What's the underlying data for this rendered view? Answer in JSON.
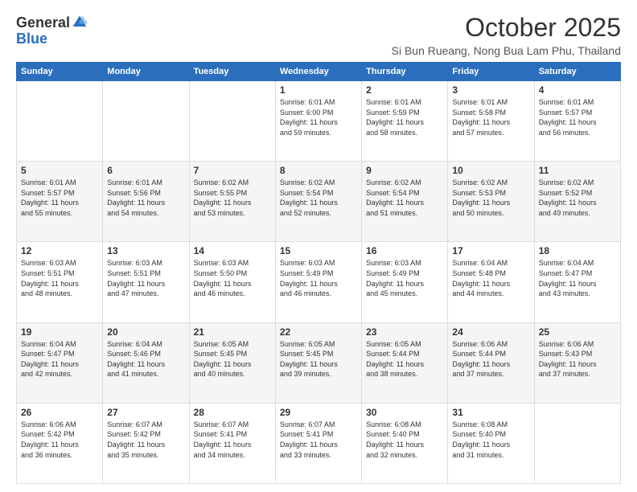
{
  "header": {
    "logo_general": "General",
    "logo_blue": "Blue",
    "month_title": "October 2025",
    "location": "Si Bun Rueang, Nong Bua Lam Phu, Thailand"
  },
  "columns": [
    "Sunday",
    "Monday",
    "Tuesday",
    "Wednesday",
    "Thursday",
    "Friday",
    "Saturday"
  ],
  "weeks": [
    [
      {
        "day": "",
        "text": ""
      },
      {
        "day": "",
        "text": ""
      },
      {
        "day": "",
        "text": ""
      },
      {
        "day": "1",
        "text": "Sunrise: 6:01 AM\nSunset: 6:00 PM\nDaylight: 11 hours\nand 59 minutes."
      },
      {
        "day": "2",
        "text": "Sunrise: 6:01 AM\nSunset: 5:59 PM\nDaylight: 11 hours\nand 58 minutes."
      },
      {
        "day": "3",
        "text": "Sunrise: 6:01 AM\nSunset: 5:58 PM\nDaylight: 11 hours\nand 57 minutes."
      },
      {
        "day": "4",
        "text": "Sunrise: 6:01 AM\nSunset: 5:57 PM\nDaylight: 11 hours\nand 56 minutes."
      }
    ],
    [
      {
        "day": "5",
        "text": "Sunrise: 6:01 AM\nSunset: 5:57 PM\nDaylight: 11 hours\nand 55 minutes."
      },
      {
        "day": "6",
        "text": "Sunrise: 6:01 AM\nSunset: 5:56 PM\nDaylight: 11 hours\nand 54 minutes."
      },
      {
        "day": "7",
        "text": "Sunrise: 6:02 AM\nSunset: 5:55 PM\nDaylight: 11 hours\nand 53 minutes."
      },
      {
        "day": "8",
        "text": "Sunrise: 6:02 AM\nSunset: 5:54 PM\nDaylight: 11 hours\nand 52 minutes."
      },
      {
        "day": "9",
        "text": "Sunrise: 6:02 AM\nSunset: 5:54 PM\nDaylight: 11 hours\nand 51 minutes."
      },
      {
        "day": "10",
        "text": "Sunrise: 6:02 AM\nSunset: 5:53 PM\nDaylight: 11 hours\nand 50 minutes."
      },
      {
        "day": "11",
        "text": "Sunrise: 6:02 AM\nSunset: 5:52 PM\nDaylight: 11 hours\nand 49 minutes."
      }
    ],
    [
      {
        "day": "12",
        "text": "Sunrise: 6:03 AM\nSunset: 5:51 PM\nDaylight: 11 hours\nand 48 minutes."
      },
      {
        "day": "13",
        "text": "Sunrise: 6:03 AM\nSunset: 5:51 PM\nDaylight: 11 hours\nand 47 minutes."
      },
      {
        "day": "14",
        "text": "Sunrise: 6:03 AM\nSunset: 5:50 PM\nDaylight: 11 hours\nand 46 minutes."
      },
      {
        "day": "15",
        "text": "Sunrise: 6:03 AM\nSunset: 5:49 PM\nDaylight: 11 hours\nand 46 minutes."
      },
      {
        "day": "16",
        "text": "Sunrise: 6:03 AM\nSunset: 5:49 PM\nDaylight: 11 hours\nand 45 minutes."
      },
      {
        "day": "17",
        "text": "Sunrise: 6:04 AM\nSunset: 5:48 PM\nDaylight: 11 hours\nand 44 minutes."
      },
      {
        "day": "18",
        "text": "Sunrise: 6:04 AM\nSunset: 5:47 PM\nDaylight: 11 hours\nand 43 minutes."
      }
    ],
    [
      {
        "day": "19",
        "text": "Sunrise: 6:04 AM\nSunset: 5:47 PM\nDaylight: 11 hours\nand 42 minutes."
      },
      {
        "day": "20",
        "text": "Sunrise: 6:04 AM\nSunset: 5:46 PM\nDaylight: 11 hours\nand 41 minutes."
      },
      {
        "day": "21",
        "text": "Sunrise: 6:05 AM\nSunset: 5:45 PM\nDaylight: 11 hours\nand 40 minutes."
      },
      {
        "day": "22",
        "text": "Sunrise: 6:05 AM\nSunset: 5:45 PM\nDaylight: 11 hours\nand 39 minutes."
      },
      {
        "day": "23",
        "text": "Sunrise: 6:05 AM\nSunset: 5:44 PM\nDaylight: 11 hours\nand 38 minutes."
      },
      {
        "day": "24",
        "text": "Sunrise: 6:06 AM\nSunset: 5:44 PM\nDaylight: 11 hours\nand 37 minutes."
      },
      {
        "day": "25",
        "text": "Sunrise: 6:06 AM\nSunset: 5:43 PM\nDaylight: 11 hours\nand 37 minutes."
      }
    ],
    [
      {
        "day": "26",
        "text": "Sunrise: 6:06 AM\nSunset: 5:42 PM\nDaylight: 11 hours\nand 36 minutes."
      },
      {
        "day": "27",
        "text": "Sunrise: 6:07 AM\nSunset: 5:42 PM\nDaylight: 11 hours\nand 35 minutes."
      },
      {
        "day": "28",
        "text": "Sunrise: 6:07 AM\nSunset: 5:41 PM\nDaylight: 11 hours\nand 34 minutes."
      },
      {
        "day": "29",
        "text": "Sunrise: 6:07 AM\nSunset: 5:41 PM\nDaylight: 11 hours\nand 33 minutes."
      },
      {
        "day": "30",
        "text": "Sunrise: 6:08 AM\nSunset: 5:40 PM\nDaylight: 11 hours\nand 32 minutes."
      },
      {
        "day": "31",
        "text": "Sunrise: 6:08 AM\nSunset: 5:40 PM\nDaylight: 11 hours\nand 31 minutes."
      },
      {
        "day": "",
        "text": ""
      }
    ]
  ]
}
